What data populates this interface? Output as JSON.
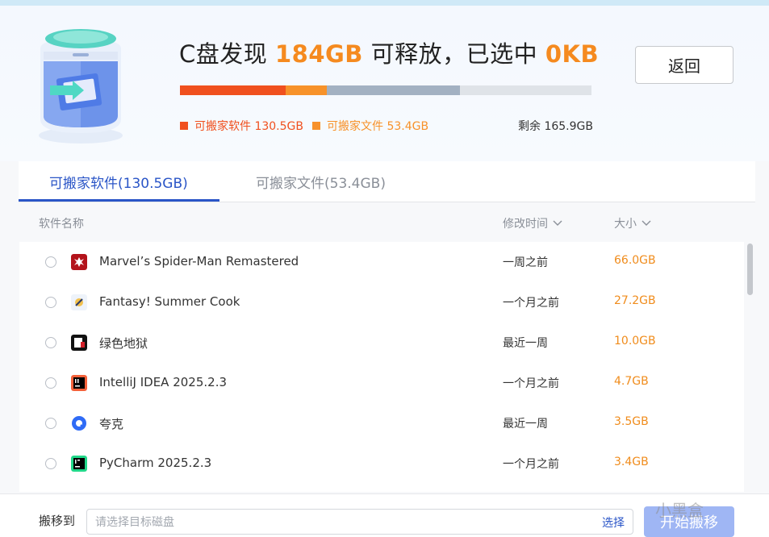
{
  "header": {
    "headline_prefix": "C盘发现 ",
    "found_amount": "184GB",
    "headline_mid": " 可释放，已选中 ",
    "selected_amount": "0KB",
    "back_label": "返回"
  },
  "usage": {
    "segments": [
      {
        "name": "software",
        "fraction": 0.256,
        "color": "#f0501e"
      },
      {
        "name": "files",
        "fraction": 0.1,
        "color": "#f7922a"
      },
      {
        "name": "used",
        "fraction": 0.325,
        "color": "#a3b1c2"
      },
      {
        "name": "free",
        "fraction": 0.319,
        "color": "#dfe3e8"
      }
    ],
    "legend_software": "可搬家软件 130.5GB",
    "legend_files": "可搬家文件 53.4GB",
    "remaining": "剩余 165.9GB",
    "software_color": "#f0501e",
    "files_color": "#f7922a"
  },
  "tabs": [
    {
      "label": "可搬家软件(130.5GB)",
      "active": true
    },
    {
      "label": "可搬家文件(53.4GB)",
      "active": false
    }
  ],
  "columns": {
    "name": "软件名称",
    "modified": "修改时间",
    "size": "大小"
  },
  "apps": [
    {
      "name": "Marvel’s Spider-Man Remastered",
      "modified": "一周之前",
      "size": "66.0GB",
      "icon": "spider-man-icon"
    },
    {
      "name": "Fantasy! Summer Cook",
      "modified": "一个月之前",
      "size": "27.2GB",
      "icon": "summer-cook-icon"
    },
    {
      "name": "绿色地狱",
      "modified": "最近一周",
      "size": "10.0GB",
      "icon": "green-hell-icon"
    },
    {
      "name": "IntelliJ IDEA 2025.2.3",
      "modified": "一个月之前",
      "size": "4.7GB",
      "icon": "intellij-icon"
    },
    {
      "name": "夸克",
      "modified": "最近一周",
      "size": "3.5GB",
      "icon": "quark-icon"
    },
    {
      "name": "PyCharm 2025.2.3",
      "modified": "一个月之前",
      "size": "3.4GB",
      "icon": "pycharm-icon"
    }
  ],
  "footer": {
    "move_to": "搬移到",
    "target_placeholder": "请选择目标磁盘",
    "choose": "选择",
    "start": "开始搬移"
  },
  "watermark": "小黑盒"
}
